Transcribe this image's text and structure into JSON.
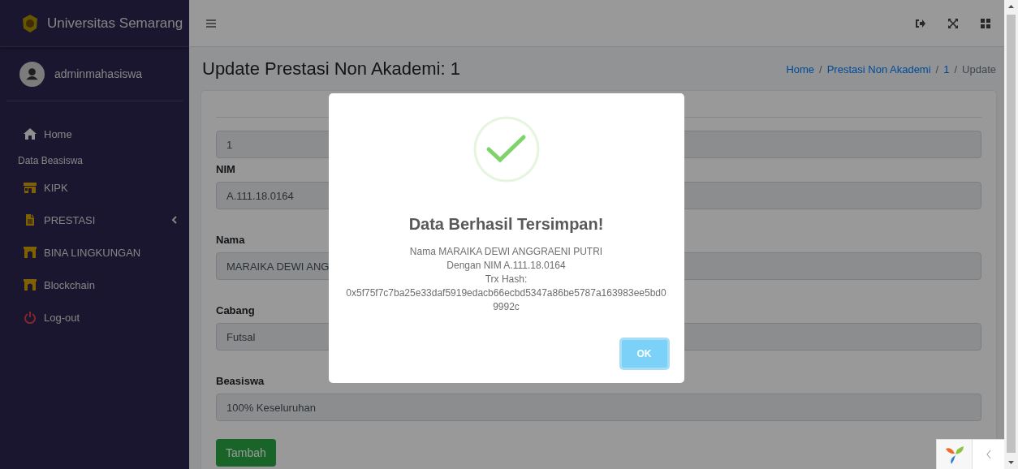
{
  "sidebar": {
    "brand": "Universitas Semarang",
    "user": "adminmahasiswa",
    "items": [
      {
        "kind": "link",
        "label": "Home",
        "has_caret": false
      },
      {
        "kind": "header",
        "label": "Data Beasiswa"
      },
      {
        "kind": "link",
        "label": "KIPK",
        "has_caret": false
      },
      {
        "kind": "link",
        "label": "PRESTASI",
        "has_caret": true
      },
      {
        "kind": "link",
        "label": "BINA LINGKUNGAN",
        "has_caret": false
      },
      {
        "kind": "link",
        "label": "Blockchain",
        "has_caret": false
      },
      {
        "kind": "link",
        "label": "Log-out",
        "has_caret": false
      }
    ]
  },
  "page": {
    "title": "Update Prestasi Non Akademi: 1",
    "breadcrumb": [
      {
        "label": "Home",
        "link": true
      },
      {
        "separator": "/",
        "label": "Prestasi Non Akademi",
        "link": true
      },
      {
        "separator": "/",
        "label": "1",
        "link": true
      },
      {
        "separator": "/",
        "label": "Update",
        "link": false
      }
    ]
  },
  "form": {
    "fields": [
      {
        "value": "1"
      },
      {
        "label": "NIM",
        "value": "A.111.18.0164"
      },
      {
        "label": "Nama",
        "value": "MARAIKA DEWI  ANG"
      },
      {
        "label": "Cabang",
        "value": "Futsal"
      },
      {
        "label": "Beasiswa",
        "value": "100% Keseluruhan"
      }
    ],
    "submit": "Tambah"
  },
  "modal": {
    "title": "Data Berhasil Tersimpan!",
    "lines": [
      "Nama MARAIKA DEWI ANGGRAENI PUTRI",
      "Dengan NIM A.111.18.0164",
      "Trx Hash:",
      "0x5f75f7c7ba25e33daf5919edacb66ecbd5347a86be5787a163983ee5bd09992c"
    ],
    "button": "OK"
  }
}
